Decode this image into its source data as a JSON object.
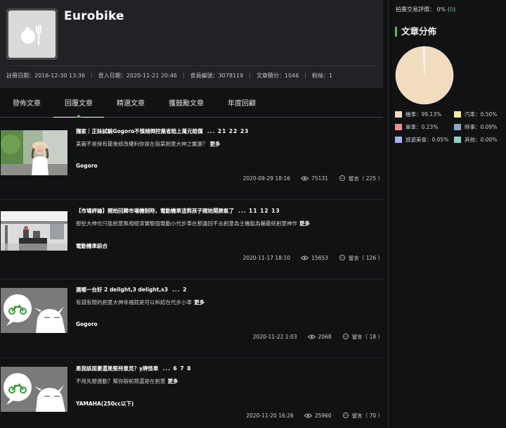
{
  "profile": {
    "username": "Eurobike",
    "stats": [
      {
        "label": "註冊日期：2016-12-30 13:36"
      },
      {
        "label": "登入日期：2020-11-21 20:46"
      },
      {
        "label": "會員編號：3078119"
      },
      {
        "label": "文章積分：1046"
      },
      {
        "label": "粉絲：1"
      }
    ]
  },
  "tabs": [
    {
      "label": "發佈文章",
      "active": false
    },
    {
      "label": "回覆文章",
      "active": true
    },
    {
      "label": "精選文章",
      "active": false
    },
    {
      "label": "獲鼓勵文章",
      "active": false
    },
    {
      "label": "年度回顧",
      "active": false
    }
  ],
  "posts": [
    {
      "title": "獨家｜正妹試騎Gogoro不慎傾倒控業者賠上萬元賠償",
      "pages": "... 21 22 23",
      "excerpt": "某廠不是保有最後修改權利你是在指某創意大神之嚴選？",
      "more": "更多",
      "category": "Gogoro",
      "date": "2020-09-29 18:16",
      "views": "75131",
      "comments": "留言（ 225 ）",
      "thumb_icon": "photo-woman-helmet"
    },
    {
      "title": "【市場評論】開始回歸市場機制時，電動機車這熊孩子開始鬧脾氣了",
      "pages": "... 11 12 13",
      "excerpt": "那些大神也只能創意無視經濟實驗個電動小代步車在那邊回不去創意為主機能為輔最終創意神作",
      "more": "更多",
      "category": "電動機車綜合",
      "date": "2020-11-17 18:10",
      "views": "15653",
      "comments": "留言（ 126 ）",
      "thumb_icon": "photo-showroom"
    },
    {
      "title": "選哪一台好 2 delight,3 delight,s3",
      "pages": "... 2",
      "excerpt": "有錢有閒的創意大神幸福就是可以糾結在代步小車",
      "more": "更多",
      "category": "Gogoro",
      "date": "2020-11-22 1:03",
      "views": "2068",
      "comments": "留言（ 18 ）",
      "thumb_icon": "motorbike-placeholder"
    },
    {
      "title": "是我該屈妻還是堅持意見？y牌怪車",
      "pages": "... 6 7 8",
      "excerpt": "不用先廢連動？幫你辦前煞還是在創意",
      "more": "更多",
      "category": "YAMAHA(250cc以下)",
      "date": "2020-11-20 16:26",
      "views": "25960",
      "comments": "留言（ 70 ）",
      "thumb_icon": "motorbike-placeholder"
    }
  ],
  "sidebar": {
    "rating_label": "拍賣交易評價：",
    "rating_value": "0%",
    "rating_count_open": "(",
    "rating_count": "0",
    "rating_count_close": ")",
    "section_title": "文章分佈",
    "legend": [
      {
        "label": "機車：99.13%",
        "color": "#f2dcc0"
      },
      {
        "label": "汽車：0.50%",
        "color": "#f4eca0"
      },
      {
        "label": "單車：0.23%",
        "color": "#ee8f8c"
      },
      {
        "label": "時事：0.09%",
        "color": "#8aa8c8"
      },
      {
        "label": "旅遊美食：0.05%",
        "color": "#aab0ee"
      },
      {
        "label": "其他：0.00%",
        "color": "#90d0c8"
      }
    ]
  },
  "chart_data": {
    "type": "pie",
    "title": "文章分佈",
    "categories": [
      "機車",
      "汽車",
      "單車",
      "時事",
      "旅遊美食",
      "其他"
    ],
    "values": [
      99.13,
      0.5,
      0.23,
      0.09,
      0.05,
      0.0
    ],
    "colors": [
      "#f2dcc0",
      "#f4eca0",
      "#ee8f8c",
      "#8aa8c8",
      "#aab0ee",
      "#90d0c8"
    ]
  }
}
